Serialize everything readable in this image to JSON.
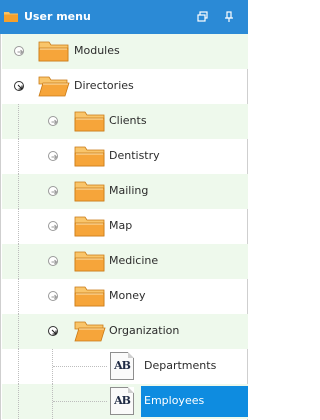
{
  "header": {
    "title": "User menu"
  },
  "tree": [
    {
      "label": "Modules",
      "level": 0,
      "state": "collapsed"
    },
    {
      "label": "Directories",
      "level": 0,
      "state": "expanded"
    },
    {
      "label": "Clients",
      "level": 1,
      "state": "collapsed"
    },
    {
      "label": "Dentistry",
      "level": 1,
      "state": "collapsed"
    },
    {
      "label": "Mailing",
      "level": 1,
      "state": "collapsed"
    },
    {
      "label": "Map",
      "level": 1,
      "state": "collapsed"
    },
    {
      "label": "Medicine",
      "level": 1,
      "state": "collapsed"
    },
    {
      "label": "Money",
      "level": 1,
      "state": "collapsed"
    },
    {
      "label": "Organization",
      "level": 1,
      "state": "expanded"
    },
    {
      "label": "Departments",
      "level": 2,
      "state": "leaf",
      "icon_text": "AB"
    },
    {
      "label": "Employees",
      "level": 2,
      "state": "leaf",
      "icon_text": "AB",
      "selected": true
    }
  ],
  "colors": {
    "header_bg": "#2b8ad6",
    "alt_row_bg": "#eef9ec",
    "selected_bg": "#0e8ce0",
    "folder": "#f7a53a"
  }
}
